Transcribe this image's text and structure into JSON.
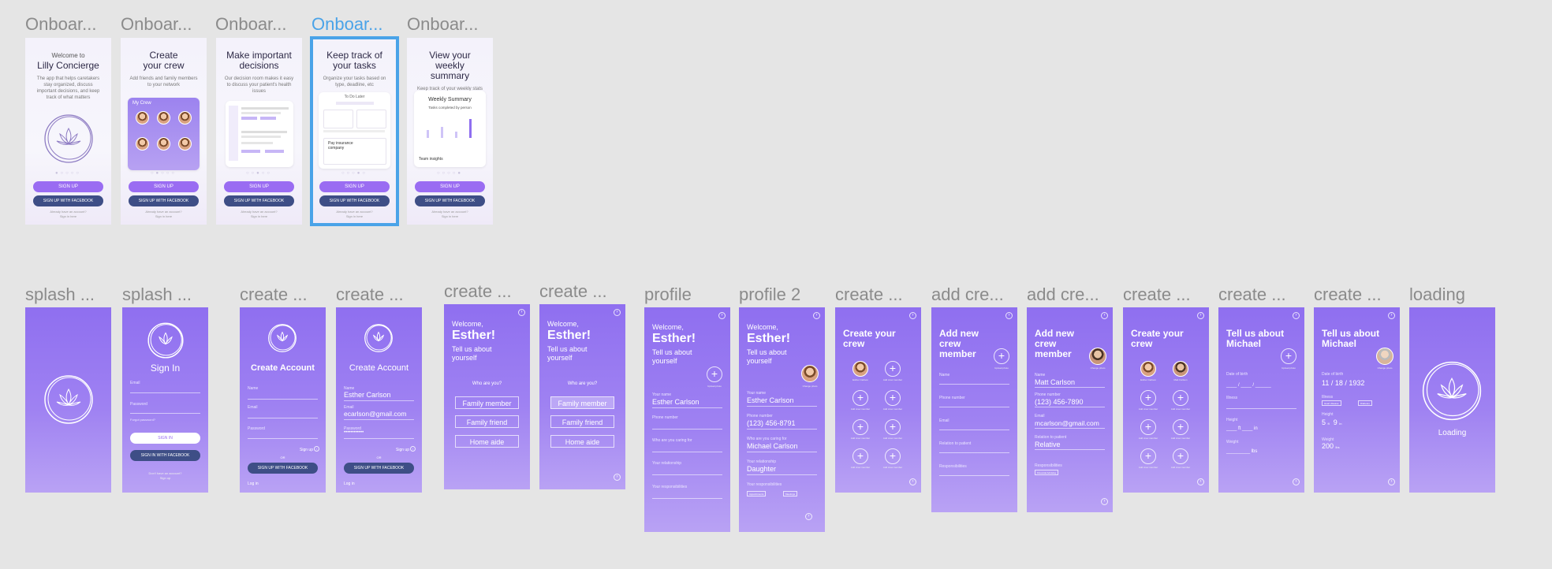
{
  "row1_labels": [
    "Onboar...",
    "Onboar...",
    "Onboar...",
    "Onboar...",
    "Onboar..."
  ],
  "row2_labels": [
    "splash ...",
    "splash ...",
    "create ...",
    "create ...",
    "create ...",
    "create ...",
    "profile",
    "profile 2",
    "create ...",
    "add cre...",
    "add cre...",
    "create ...",
    "create ...",
    "create ...",
    "loading"
  ],
  "onboarding": [
    {
      "intro": "Welcome to",
      "title": "Lilly Concierge",
      "desc": "The app that helps caretakers stay organized, discuss important decisions, and keep track of what matters"
    },
    {
      "intro": "",
      "title": "Create your crew",
      "desc": "Add friends and family members to your network",
      "card_title": "My Crew"
    },
    {
      "intro": "",
      "title": "Make important decisions",
      "desc": "Our decision room makes it easy to discuss your patient's health issues"
    },
    {
      "intro": "",
      "title": "Keep track of your tasks",
      "desc": "Organize your tasks based on type, deadline, etc",
      "card_title": "To Do Later",
      "card_item": "Pay insurance company"
    },
    {
      "intro": "",
      "title": "View your weekly summary",
      "desc": "Keep track of your weekly stats and progress",
      "card_title": "Weekly Summary",
      "card_sub": "Tasks completed by person",
      "card_foot": "Team insights"
    }
  ],
  "buttons": {
    "signup": "SIGN UP",
    "facebook": "SIGN UP WITH FACEBOOK",
    "signin_fb": "SIGN IN WITH FACEBOOK",
    "signin": "SIGN IN",
    "have_account": "Already have an account?",
    "sign_in_link": "Sign in here",
    "no_account": "Don't have an account?",
    "sign_up_link": "Sign up",
    "login": "Log in",
    "signup_small": "Sign up"
  },
  "signin": {
    "title": "Sign In",
    "email": "Email",
    "password": "Password",
    "forgot": "Forgot password?"
  },
  "create_account": {
    "title": "Create Account",
    "name_label": "Name",
    "email_label": "Email",
    "password_label": "Password",
    "name_value": "Esther Carlson",
    "email_value": "ecarlson@gmail.com",
    "password_value": "••••••••••••",
    "or": "OR"
  },
  "welcome": {
    "welcome": "Welcome,",
    "name": "Esther!",
    "tell": "Tell us about yourself",
    "who": "Who are you?",
    "options": [
      "Family member",
      "Family friend",
      "Home aide"
    ]
  },
  "profile": {
    "photo_label": "Upload photo",
    "change_photo": "Change photo",
    "your_name": "Your name",
    "phone": "Phone number",
    "caring_for": "Who are you caring for",
    "relationship": "Your relationship",
    "responsibilities": "Your responsibilities",
    "name_value": "Esther Carlson",
    "phone_value": "(123) 456-8791",
    "caring_value": "Michael Carlson",
    "relationship_value": "Daughter",
    "chips": [
      "Appointments",
      "Meetings"
    ]
  },
  "crew": {
    "title": "Create your crew",
    "add_label": "Add crew member",
    "member1": "Esther Carlson",
    "member2": "Matt Carlson"
  },
  "add_crew": {
    "title": "Add new crew member",
    "name": "Name",
    "phone": "Phone number",
    "email": "Email",
    "relation": "Relation to patient",
    "responsibilities": "Responsibilities",
    "name_value": "Matt Carlson",
    "phone_value": "(123) 456-7890",
    "email_value": "mcarlson@gmail.com",
    "relation_value": "Relative",
    "chip": "Financial Advising"
  },
  "michael": {
    "title": "Tell us about Michael",
    "dob": "Date of birth",
    "illness": "Illness",
    "height": "Height",
    "weight": "Weight",
    "dob_value": [
      "11",
      "18",
      "1932"
    ],
    "height_value": [
      "5",
      "9"
    ],
    "height_units": [
      "ft",
      "in"
    ],
    "weight_value": "200",
    "weight_unit": "lbs",
    "chips": [
      "Heart disease",
      "Diabetes"
    ]
  },
  "loading": {
    "text": "Loading"
  },
  "colors": {
    "bg": "#e5e5e5",
    "purple": "#8f6ff0",
    "accent_blue": "#4aa3e8",
    "fb": "#3e4e86"
  }
}
